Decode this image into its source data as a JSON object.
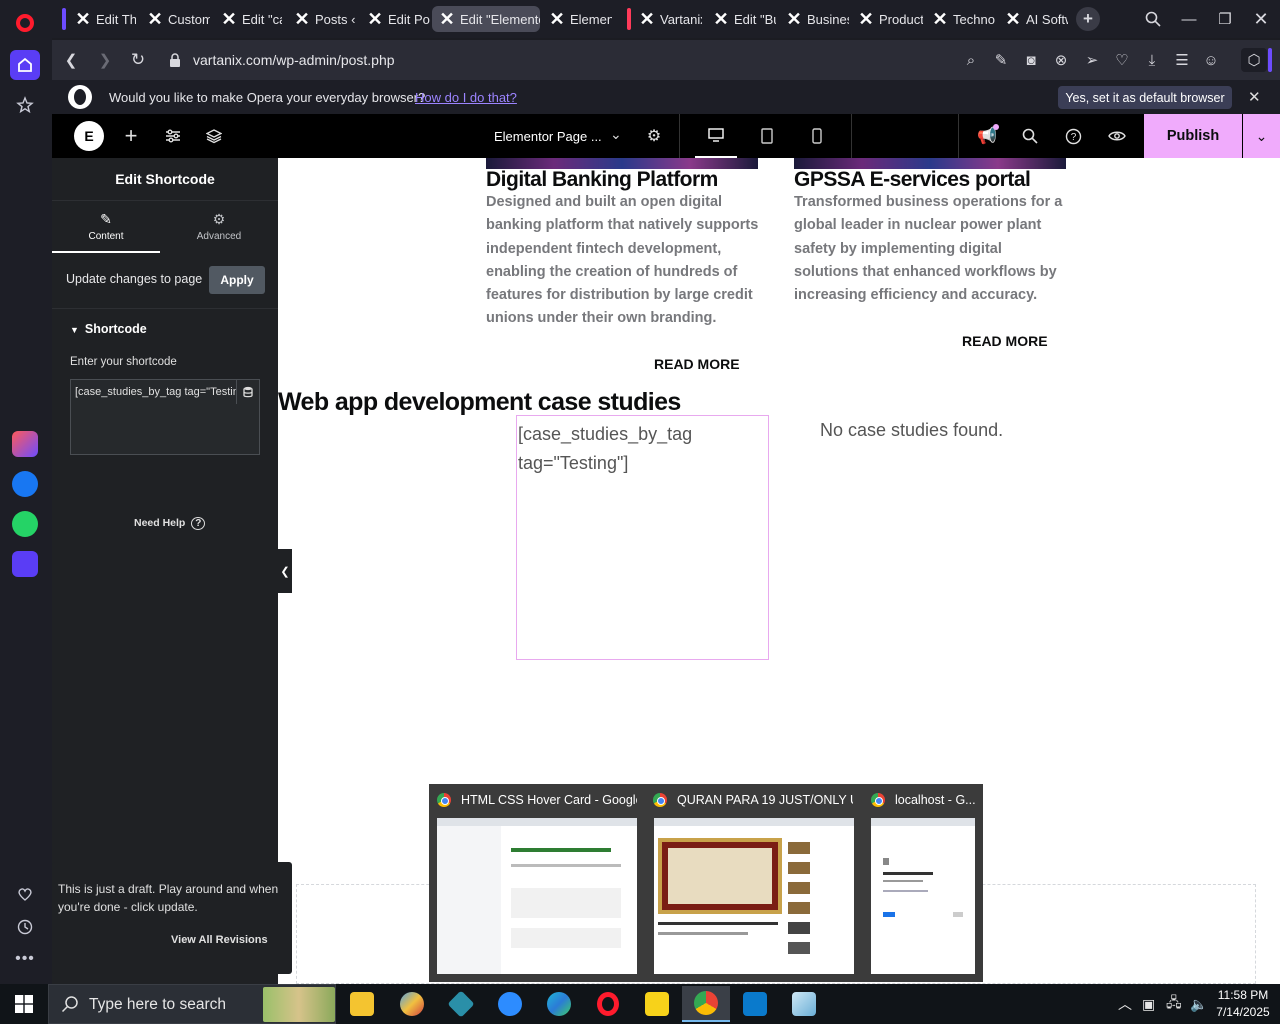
{
  "browser": {
    "tabs": [
      {
        "label": "Edit The"
      },
      {
        "label": "Custom"
      },
      {
        "label": "Edit \"ca"
      },
      {
        "label": "Posts ‹ V"
      },
      {
        "label": "Edit Pos"
      },
      {
        "label": "Edit \"Elemento",
        "active": true
      },
      {
        "label": "Element"
      },
      {
        "label": "Vartanix"
      },
      {
        "label": "Edit \"Bu"
      },
      {
        "label": "Busines"
      },
      {
        "label": "Product"
      },
      {
        "label": "Technol"
      },
      {
        "label": "AI Softw"
      }
    ],
    "url": "vartanix.com/wp-admin/post.php",
    "default_prompt": {
      "question": "Would you like to make Opera your everyday browser?",
      "link": "How do I do that?",
      "button": "Yes, set it as default browser"
    }
  },
  "elementor": {
    "page_title": "Elementor Page ...",
    "publish_label": "Publish",
    "panel": {
      "title": "Edit Shortcode",
      "tabs": [
        {
          "label": "Content",
          "icon": "pencil-icon",
          "active": true
        },
        {
          "label": "Advanced",
          "icon": "gear-icon",
          "active": false
        }
      ],
      "update_text": "Update changes to page",
      "apply_label": "Apply",
      "section_title": "Shortcode",
      "field_label": "Enter your shortcode",
      "field_value": "[case_studies_by_tag tag=\"Testing\"]",
      "need_help": "Need Help",
      "draft_text": "This is just a draft. Play around and when you're done - click update.",
      "view_revisions": "View All Revisions"
    }
  },
  "canvas": {
    "cards": [
      {
        "title": "Digital Banking Platform",
        "description": "Designed and built an open digital banking platform that natively supports independent fintech development, enabling the creation of hundreds of features for distribution by large credit unions under their own branding.",
        "read_more": "READ MORE"
      },
      {
        "title": "GPSSA E-services portal",
        "description": "Transformed business operations for a global leader in nuclear power plant safety by implementing digital solutions that enhanced workflows by increasing efficiency and accuracy.",
        "read_more": "READ MORE"
      }
    ],
    "section_heading": "Web app development case studies",
    "shortcode_preview": "[case_studies_by_tag tag=\"Testing\"]",
    "no_results": "No case studies found."
  },
  "chrome_thumbnails": [
    {
      "title": "HTML CSS Hover Card - Google..."
    },
    {
      "title": "QURAN PARA 19 JUST/ONLY U..."
    },
    {
      "title": "localhost - G..."
    }
  ],
  "taskbar": {
    "search_placeholder": "Type here to search",
    "time": "11:58 PM",
    "date": "7/14/2025"
  }
}
